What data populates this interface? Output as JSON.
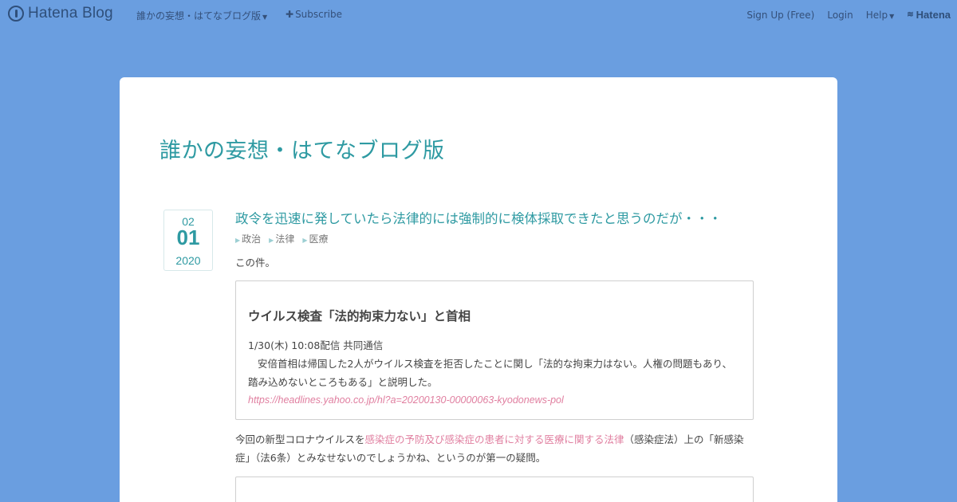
{
  "header": {
    "brand": "Hatena Blog",
    "blog_menu": "誰かの妄想・はてなブログ版",
    "subscribe": "Subscribe",
    "signup": "Sign Up (Free)",
    "login": "Login",
    "help": "Help",
    "hatena": "Hatena"
  },
  "blog": {
    "title": "誰かの妄想・はてなブログ版"
  },
  "entry": {
    "date": {
      "month": "02",
      "day": "01",
      "year": "2020"
    },
    "title": "政令を迅速に発していたら法律的には強制的に検体採取できたと思うのだが・・・",
    "categories": [
      "政治",
      "法律",
      "医療"
    ],
    "intro": "この件。",
    "quote": {
      "heading": "ウイルス検査「法的拘束力ない」と首相",
      "meta": "1/30(木) 10:08配信 共同通信",
      "body": "安倍首相は帰国した2人がウイルス検査を拒否したことに関し「法的な拘束力はない。人権の問題もあり、踏み込めないところもある」と説明した。",
      "link": "https://headlines.yahoo.co.jp/hl?a=20200130-00000063-kyodonews-pol"
    },
    "paragraph": {
      "before": "今回の新型コロナウイルスを",
      "link": "感染症の予防及び感染症の患者に対する医療に関する法律",
      "after": "（感染症法）上の「新感染症」（法6条）とみなせないのでしょうかね、というのが第一の疑問。"
    }
  },
  "colors": {
    "background": "#6a9ee0",
    "accent": "#2e9aa2",
    "link": "#e07fa0"
  }
}
